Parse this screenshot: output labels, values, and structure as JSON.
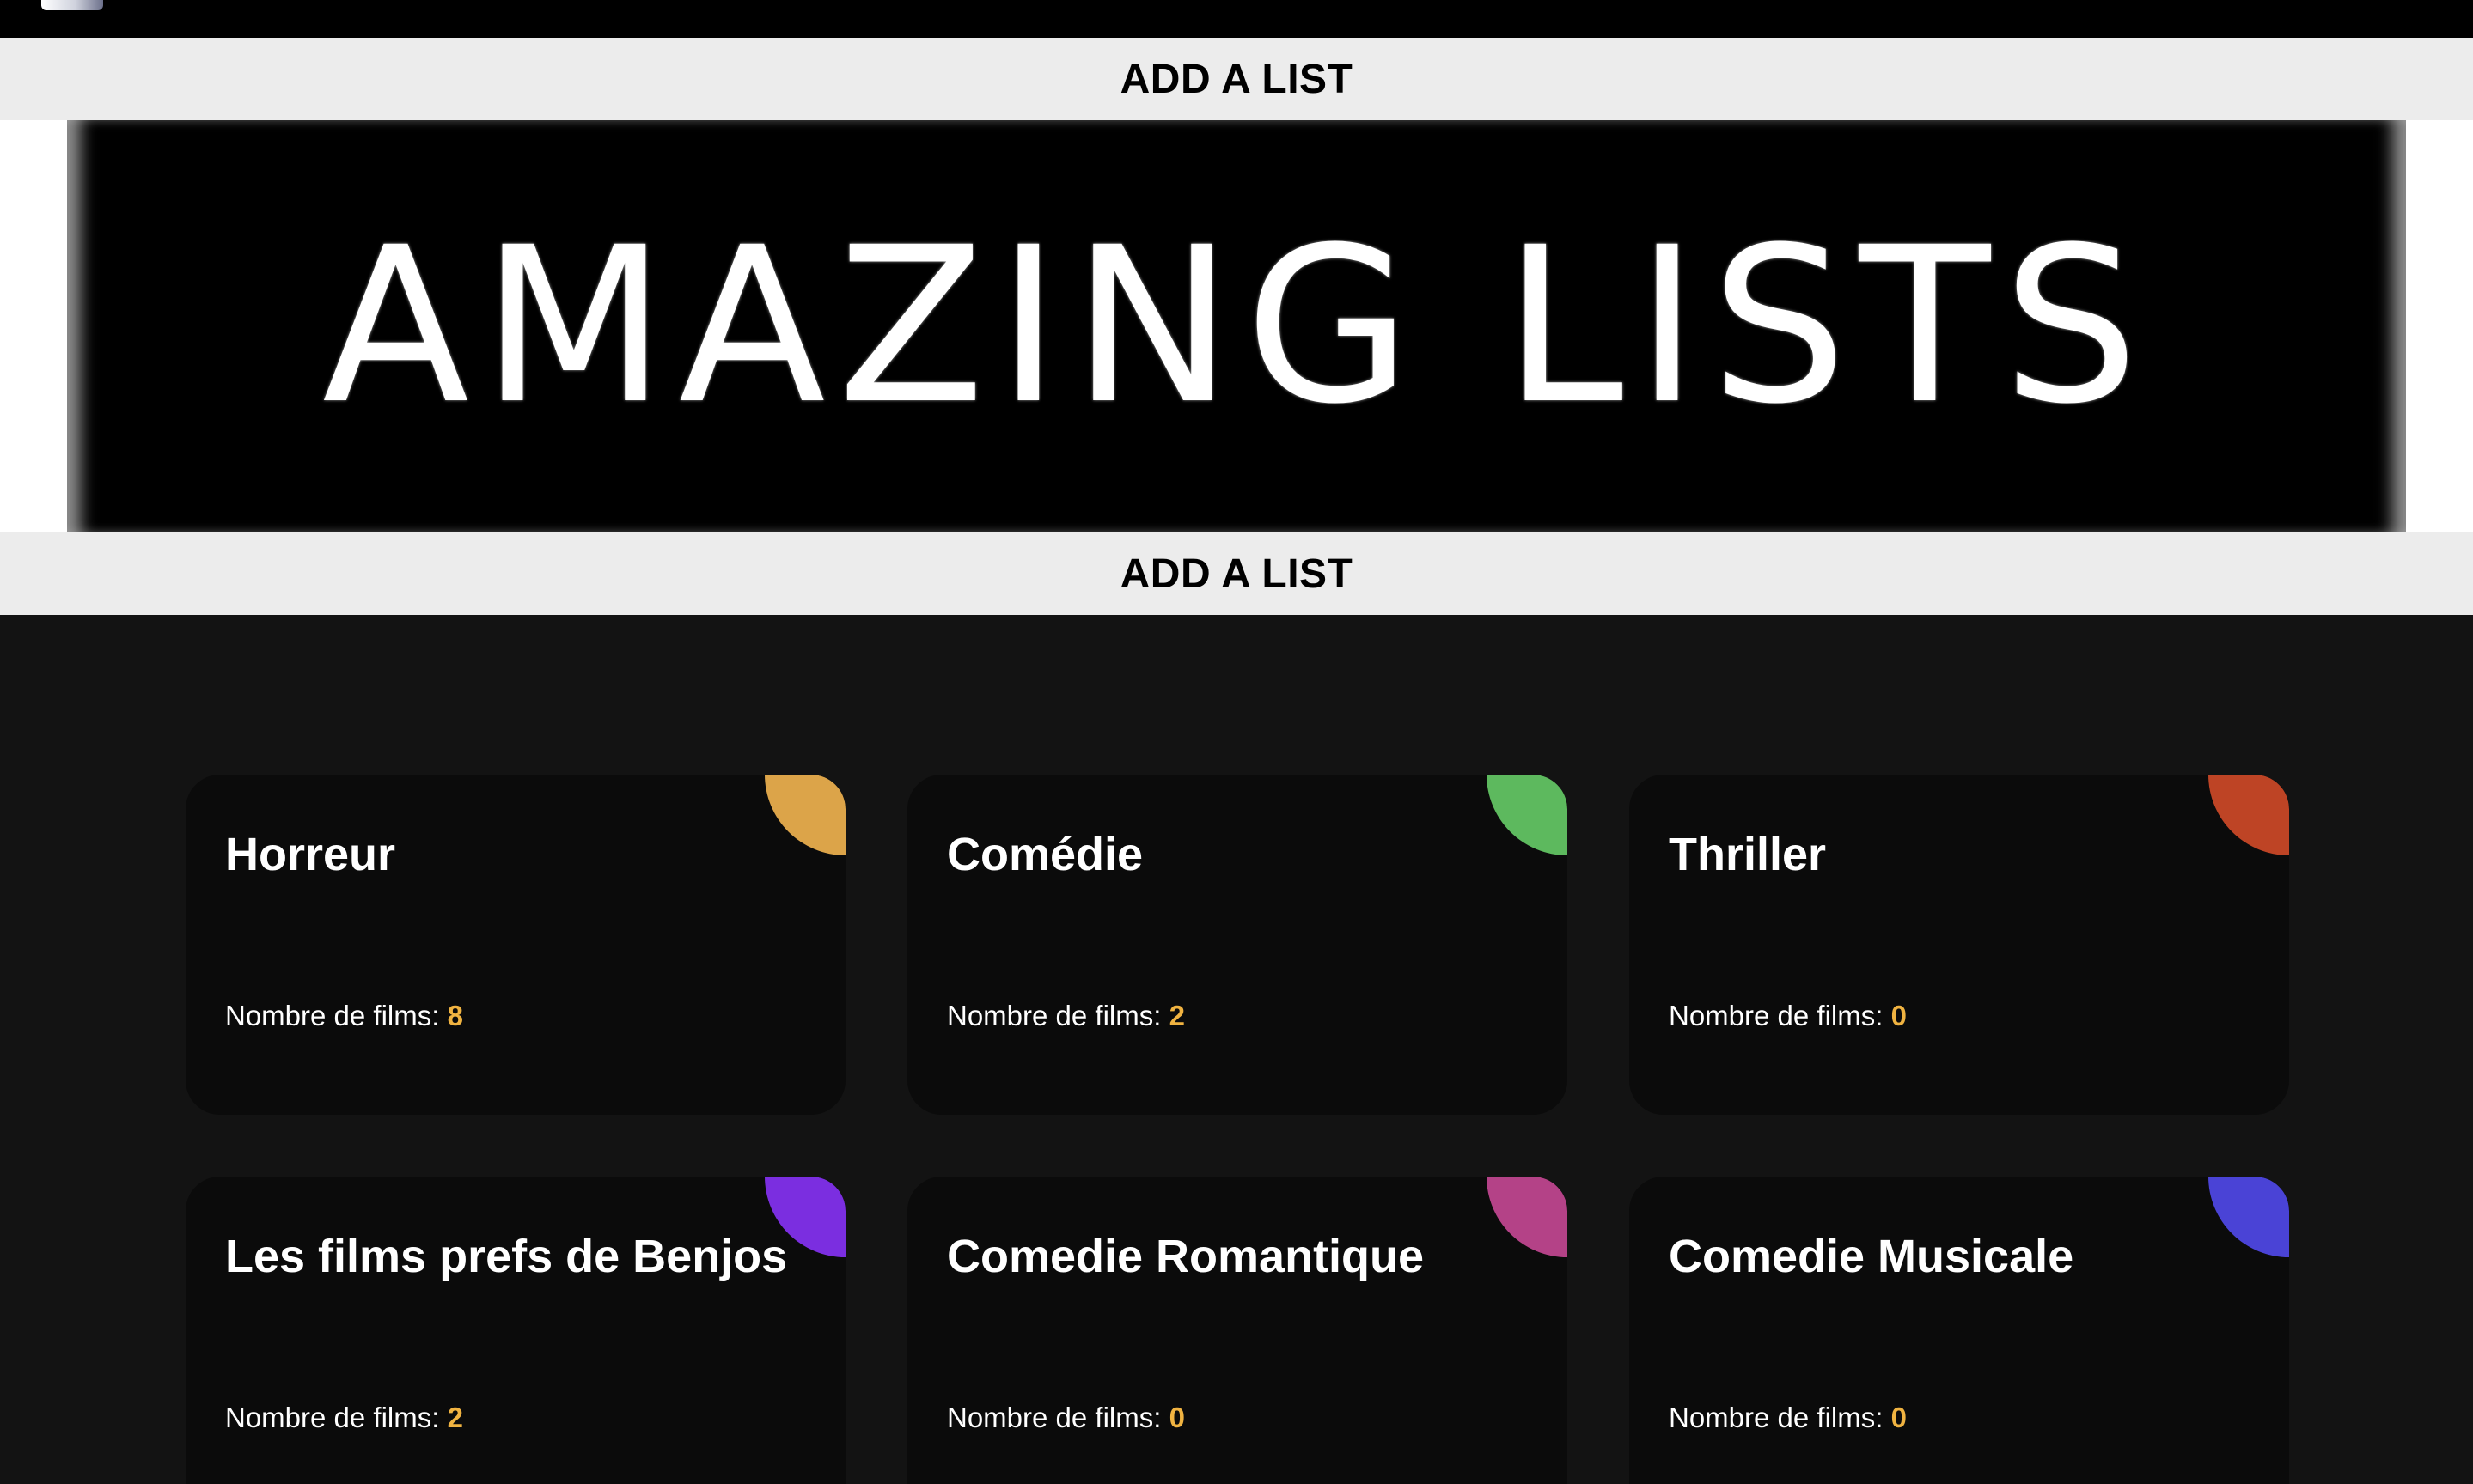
{
  "header": {
    "add_list_top": "ADD A LIST",
    "add_list_bottom": "ADD A LIST"
  },
  "hero": {
    "title": "AMAZING LISTS"
  },
  "lists": [
    {
      "name": "Horreur",
      "count_label": "Nombre de films:",
      "count": "8",
      "accent": "#dca449"
    },
    {
      "name": "Comédie",
      "count_label": "Nombre de films:",
      "count": "2",
      "accent": "#5db95e"
    },
    {
      "name": "Thriller",
      "count_label": "Nombre de films:",
      "count": "0",
      "accent": "#be4425"
    },
    {
      "name": "Les films prefs de Benjos",
      "count_label": "Nombre de films:",
      "count": "2",
      "accent": "#7b2ee0"
    },
    {
      "name": "Comedie Romantique",
      "count_label": "Nombre de films:",
      "count": "0",
      "accent": "#b44287"
    },
    {
      "name": "Comedie Musicale",
      "count_label": "Nombre de films:",
      "count": "0",
      "accent": "#4a43d6"
    }
  ],
  "colors": {
    "count_value": "#f0b341",
    "page_background": "#131313",
    "card_background": "#0b0b0b",
    "add_bar_background": "#ececec"
  }
}
